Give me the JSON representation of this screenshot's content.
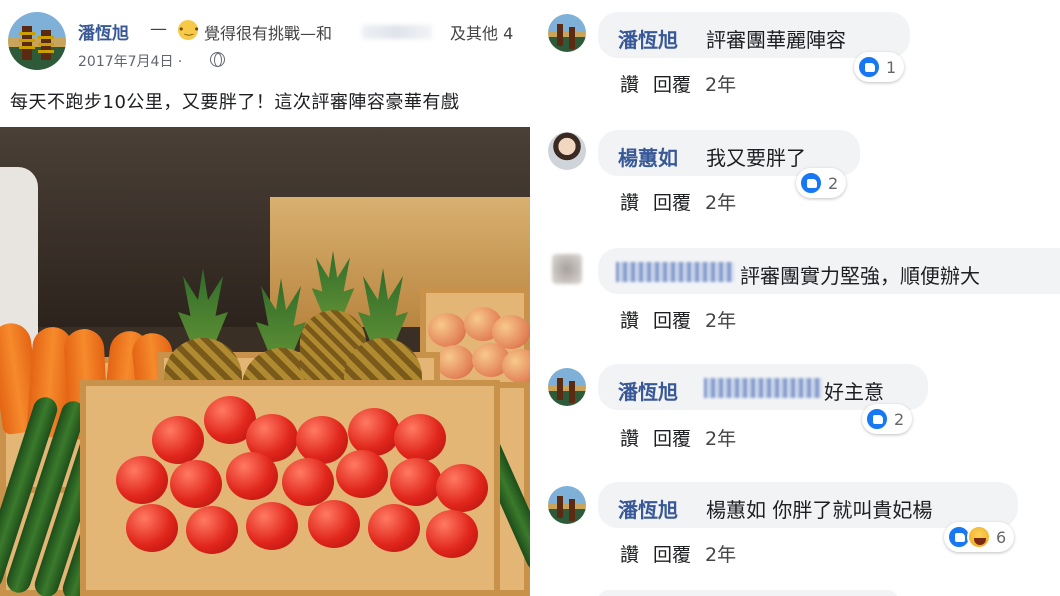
{
  "post": {
    "author": "潘恆旭",
    "dash": "—",
    "feeling_emoji": "•‿•",
    "feeling_text": "覺得很有挑戰—和",
    "others": "及其他 4",
    "date": "2017年7月4日 ·",
    "text": "每天不跑步10公里，又要胖了！這次評審陣容豪華有戲"
  },
  "comments": [
    {
      "name": "潘恆旭",
      "text": "評審團華麗陣容",
      "avatar": "pagodas",
      "reactions": [
        "like"
      ],
      "count": "1",
      "like": "讚",
      "reply": "回覆",
      "time": "2年"
    },
    {
      "name": "楊蕙如",
      "text": "我又要胖了",
      "avatar": "person",
      "reactions": [
        "like"
      ],
      "count": "2",
      "like": "讚",
      "reply": "回覆",
      "time": "2年"
    },
    {
      "name": "",
      "text": "評審團實力堅強，順便辦大",
      "avatar": "blurred",
      "reactions": [],
      "count": "",
      "like": "讚",
      "reply": "回覆",
      "time": "2年"
    },
    {
      "name": "潘恆旭",
      "text": "好主意",
      "avatar": "pagodas",
      "reactions": [
        "like"
      ],
      "count": "2",
      "like": "讚",
      "reply": "回覆",
      "time": "2年"
    },
    {
      "name": "潘恆旭",
      "text": "楊蕙如 你胖了就叫貴妃楊",
      "avatar": "pagodas",
      "reactions": [
        "like",
        "haha"
      ],
      "count": "6",
      "like": "讚",
      "reply": "回覆",
      "time": "2年"
    }
  ],
  "colors": {
    "name_link": "#385898",
    "bubble": "#f2f3f5",
    "like_blue": "#1877f2"
  },
  "icons": [
    "globe-icon",
    "like-icon",
    "haha-icon"
  ]
}
